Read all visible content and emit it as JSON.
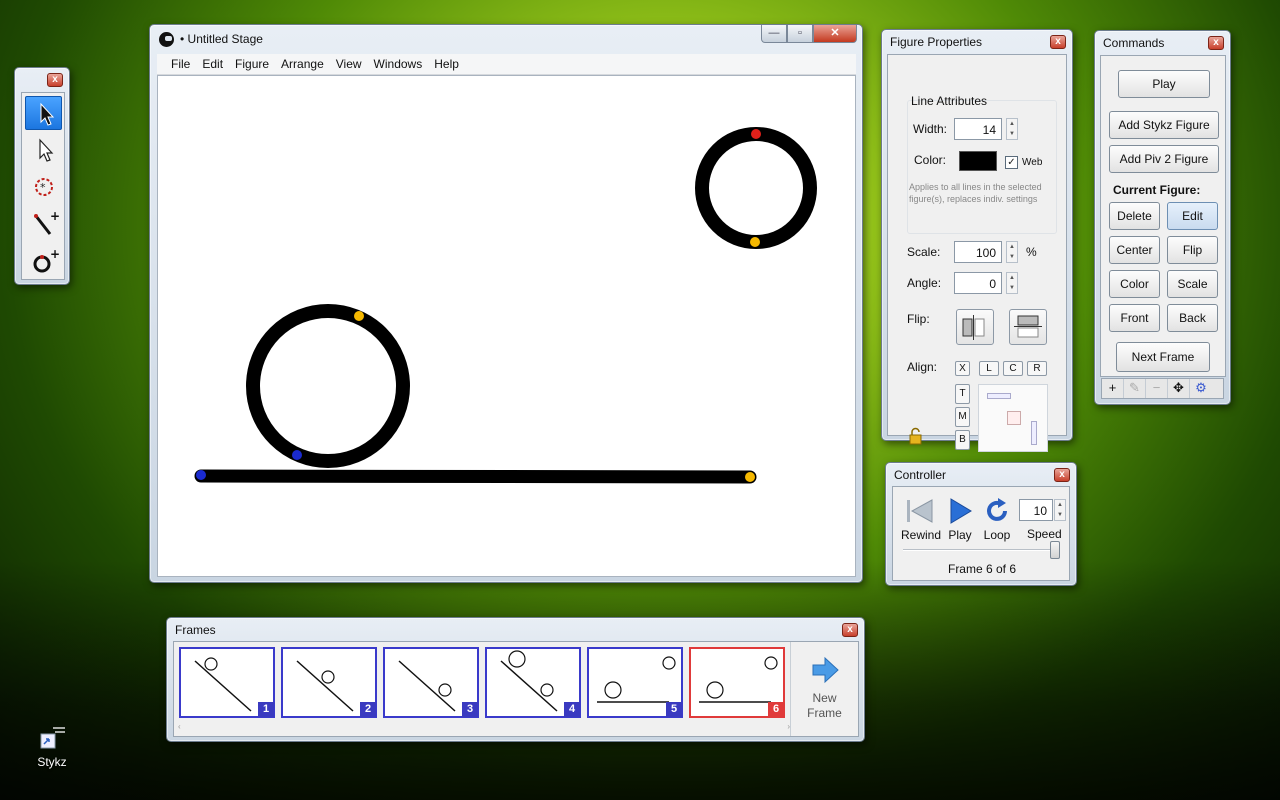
{
  "stage": {
    "title": "• Untitled Stage",
    "menu": [
      "File",
      "Edit",
      "Figure",
      "Arrange",
      "View",
      "Windows",
      "Help"
    ],
    "caption_buttons": {
      "minimize": "—",
      "maximize": "▫",
      "close": "✕"
    }
  },
  "toolbox": {
    "close": "x",
    "tools": [
      "select-arrow",
      "select-arrow-hollow",
      "pivot-target",
      "add-line",
      "add-circle"
    ]
  },
  "figure_properties": {
    "title": "Figure Properties",
    "close": "x",
    "line_attributes_label": "Line Attributes",
    "width_label": "Width:",
    "width_value": "14",
    "color_label": "Color:",
    "color_value": "#000000",
    "web_label": "Web",
    "web_checked": "✓",
    "note": "Applies to all lines in the selected figure(s), replaces indiv. settings",
    "scale_label": "Scale:",
    "scale_value": "100",
    "scale_unit": "%",
    "angle_label": "Angle:",
    "angle_value": "0",
    "flip_label": "Flip:",
    "align_label": "Align:",
    "align_x": "X",
    "align_l": "L",
    "align_c": "C",
    "align_r": "R",
    "align_t": "T",
    "align_m": "M",
    "align_b": "B"
  },
  "commands": {
    "title": "Commands",
    "close": "x",
    "play": "Play",
    "add_stykz": "Add Stykz Figure",
    "add_piv": "Add Piv 2 Figure",
    "current_figure": "Current Figure:",
    "delete": "Delete",
    "edit": "Edit",
    "center": "Center",
    "flip": "Flip",
    "color": "Color",
    "scale": "Scale",
    "front": "Front",
    "back": "Back",
    "next_frame": "Next Frame",
    "bottom_tools": [
      "+",
      "✎",
      "−",
      "✥",
      "⚙"
    ]
  },
  "controller": {
    "title": "Controller",
    "close": "x",
    "rewind": "Rewind",
    "play": "Play",
    "loop": "Loop",
    "speed_label": "Speed",
    "speed_value": "10",
    "frame_status": "Frame 6 of 6",
    "speed_slider_fraction": 1.0
  },
  "frames": {
    "title": "Frames",
    "close": "x",
    "items": [
      "1",
      "2",
      "3",
      "4",
      "5",
      "6"
    ],
    "current": "6",
    "new_frame_line1": "New",
    "new_frame_line2": "Frame"
  },
  "desktop": {
    "icon_label": "Stykz"
  },
  "colors": {
    "selection_blue": "#3a3acb",
    "current_red": "#e03a3a",
    "joint_red": "#e0201a",
    "joint_yellow": "#f5b800",
    "joint_blue": "#1a2ad0"
  }
}
